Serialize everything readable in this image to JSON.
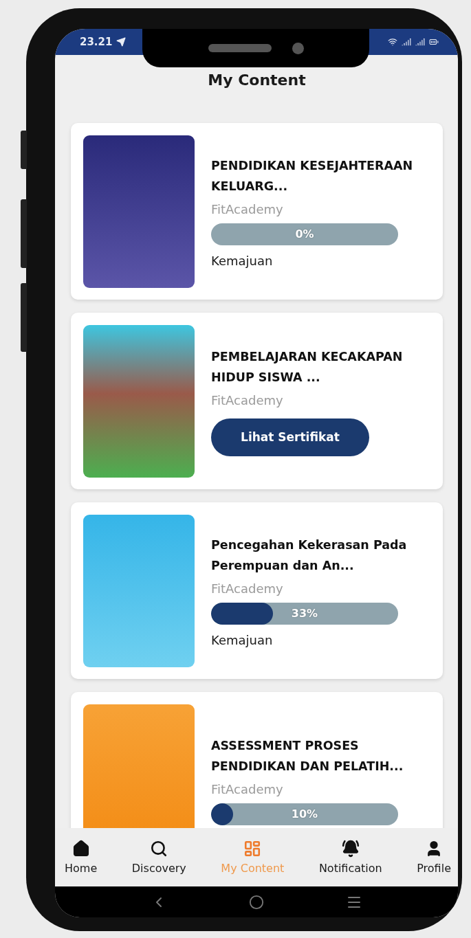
{
  "status_bar": {
    "time": "23.21"
  },
  "title": "My Content",
  "courses": [
    {
      "kind": "progress",
      "title": "PENDIDIKAN KESEJAHTERAAN KELUARG...",
      "provider": "FitAcademy",
      "level": 0,
      "reading": "0%",
      "label": "Kemajuan"
    },
    {
      "kind": "certificate",
      "title": "PEMBELAJARAN KECAKAPAN HIDUP SISWA ...",
      "provider": "FitAcademy",
      "button": "Lihat Sertifikat"
    },
    {
      "kind": "progress",
      "title": "Pencegahan Kekerasan Pada Perempuan dan An...",
      "provider": "FitAcademy",
      "level": 0.33,
      "reading": "33%",
      "label": "Kemajuan"
    },
    {
      "kind": "progress",
      "title": "ASSESSMENT PROSES PENDIDIKAN DAN PELATIH...",
      "provider": "FitAcademy",
      "level": 0.1,
      "reading": "10%"
    }
  ],
  "nav": [
    {
      "kind": "home",
      "label": "Home",
      "selected": false
    },
    {
      "kind": "search",
      "label": "Discovery",
      "selected": false
    },
    {
      "kind": "content",
      "label": "My Content",
      "selected": true
    },
    {
      "kind": "bell",
      "label": "Notification",
      "selected": false
    },
    {
      "kind": "profile",
      "label": "Profile",
      "selected": false
    }
  ]
}
